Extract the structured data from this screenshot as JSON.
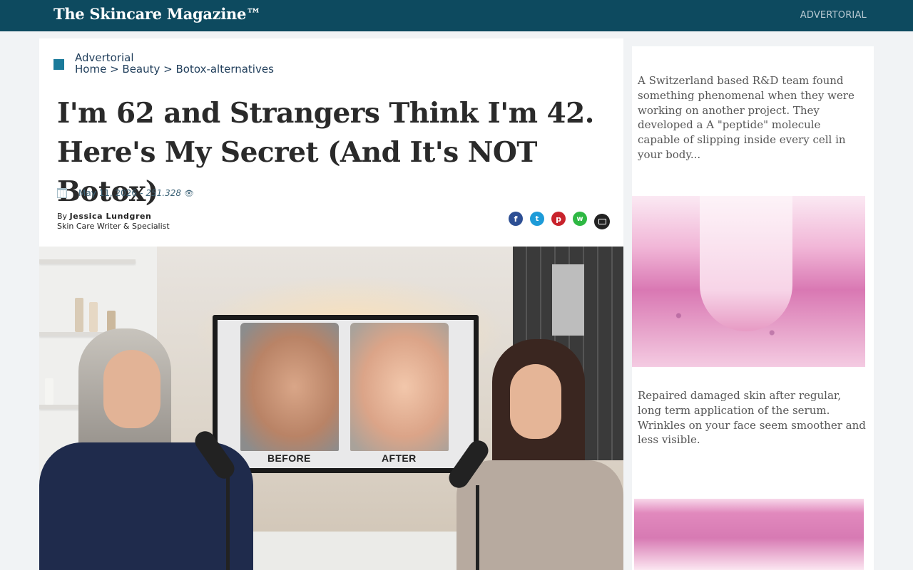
{
  "header": {
    "brand": "The Skincare Magazine™",
    "tag": "ADVERTORIAL"
  },
  "article": {
    "category_label": "Advertorial",
    "breadcrumb": {
      "items": [
        "Home",
        "Beauty",
        "Botox-alternatives"
      ],
      "separator": " > "
    },
    "headline": "I'm 62 and Strangers Think I'm 42. Here's My Secret (And It's NOT Botox)",
    "date": "May 11, 2026",
    "meta_sep": "-",
    "views": "251.328",
    "by_prefix": "By",
    "author": "Jessica Lundgren",
    "author_title": "Skin Care Writer & Specialist",
    "share": {
      "facebook": "f",
      "twitter": "t",
      "pinterest": "p",
      "whatsapp": "w"
    },
    "hero": {
      "before_label": "BEFORE",
      "after_label": "AFTER"
    }
  },
  "sidebar": {
    "text1": "A Switzerland based R&D team found something phenomenal when they were working on another project. They developed a A \"peptide\" molecule capable of slipping inside every cell in your body...",
    "text2": "Repaired damaged skin after regular, long term application of the serum. Wrinkles on your face seem smoother and less visible."
  },
  "colors": {
    "header_bg": "#0d4a5f",
    "accent": "#1a7a9a",
    "facebook": "#2d4f94",
    "twitter": "#1d9bd8",
    "pinterest": "#c8232c",
    "whatsapp": "#2eb843"
  },
  "icons": [
    "calendar-icon",
    "eye-icon",
    "facebook-icon",
    "twitter-icon",
    "pinterest-icon",
    "whatsapp-icon",
    "email-icon"
  ]
}
